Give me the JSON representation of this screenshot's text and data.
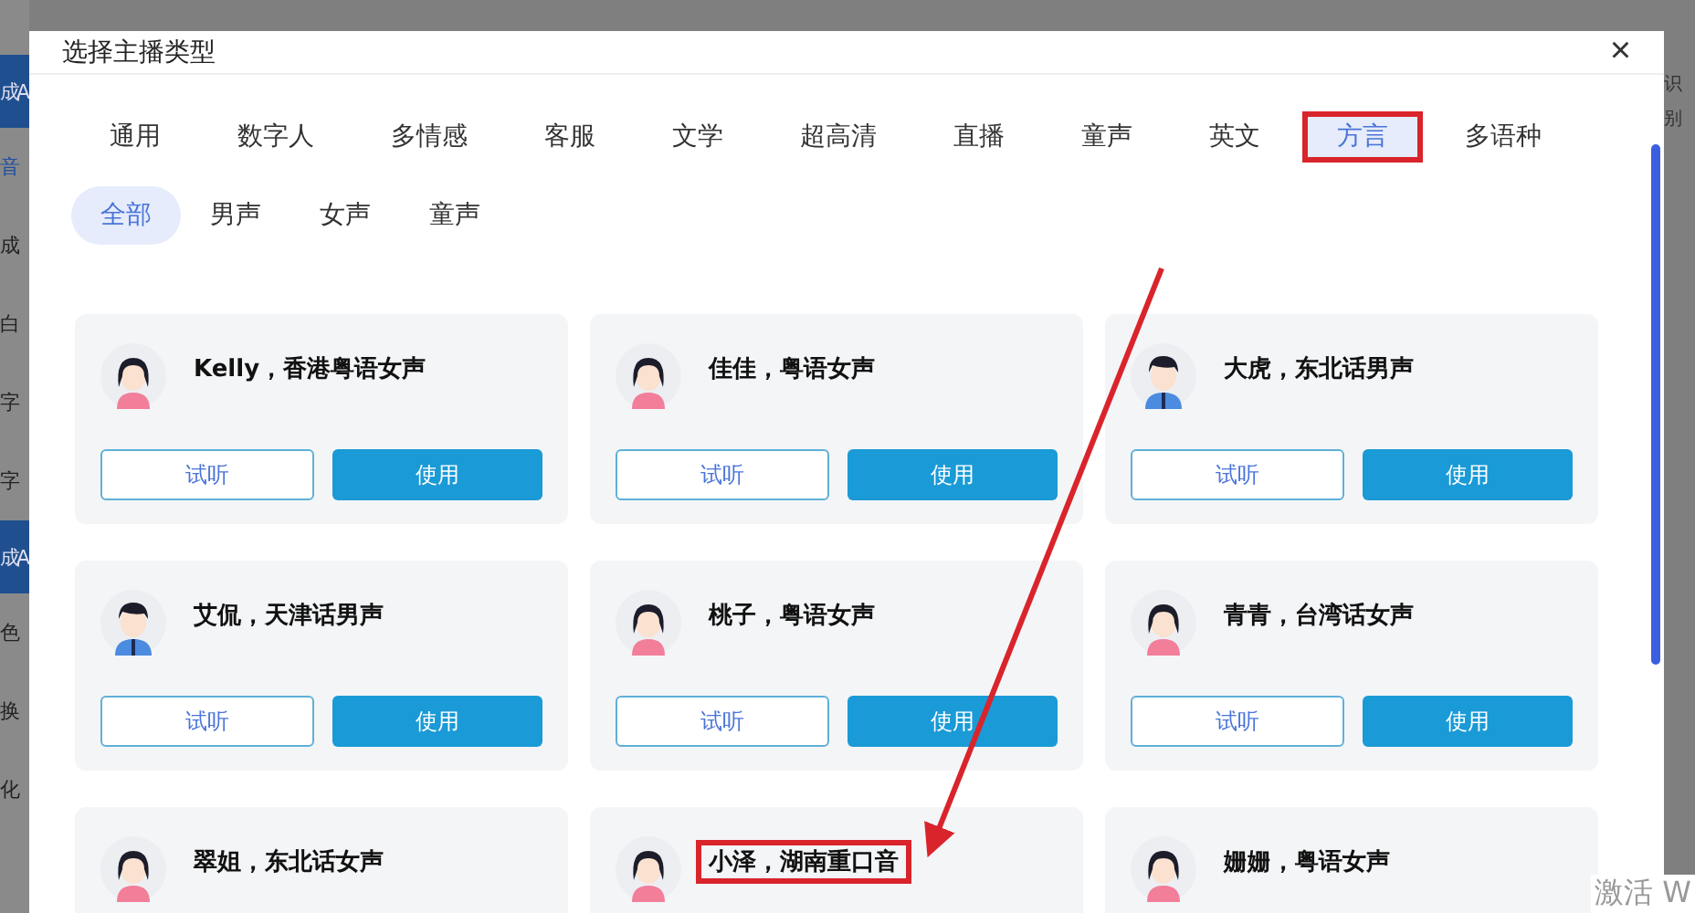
{
  "background": {
    "left_items": [
      {
        "text": "成A",
        "kind": "banner"
      },
      {
        "text": "音",
        "kind": "link"
      },
      {
        "text": "成",
        "kind": "plain"
      },
      {
        "text": "白",
        "kind": "plain"
      },
      {
        "text": "字",
        "kind": "plain"
      },
      {
        "text": "字",
        "kind": "plain"
      },
      {
        "text": "成A",
        "kind": "banner"
      },
      {
        "text": "色",
        "kind": "plain"
      },
      {
        "text": "换",
        "kind": "plain"
      },
      {
        "text": "化",
        "kind": "plain"
      }
    ],
    "right_text": "识别",
    "system_notice": "激活 W"
  },
  "dialog": {
    "title": "选择主播类型",
    "close": "×"
  },
  "tabs": [
    {
      "label": "通用",
      "selected": false,
      "highlighted": false
    },
    {
      "label": "数字人",
      "selected": false,
      "highlighted": false
    },
    {
      "label": "多情感",
      "selected": false,
      "highlighted": false
    },
    {
      "label": "客服",
      "selected": false,
      "highlighted": false
    },
    {
      "label": "文学",
      "selected": false,
      "highlighted": false
    },
    {
      "label": "超高清",
      "selected": false,
      "highlighted": false
    },
    {
      "label": "直播",
      "selected": false,
      "highlighted": false
    },
    {
      "label": "童声",
      "selected": false,
      "highlighted": false
    },
    {
      "label": "英文",
      "selected": false,
      "highlighted": false
    },
    {
      "label": "方言",
      "selected": true,
      "highlighted": true
    },
    {
      "label": "多语种",
      "selected": false,
      "highlighted": false
    }
  ],
  "filters": [
    {
      "label": "全部",
      "selected": true
    },
    {
      "label": "男声",
      "selected": false
    },
    {
      "label": "女声",
      "selected": false
    },
    {
      "label": "童声",
      "selected": false
    }
  ],
  "voices": [
    {
      "name": "Kelly，香港粤语女声",
      "kind": "female",
      "highlighted": false,
      "preview": "试听",
      "use": "使用"
    },
    {
      "name": "佳佳，粤语女声",
      "kind": "female",
      "highlighted": false,
      "preview": "试听",
      "use": "使用"
    },
    {
      "name": "大虎，东北话男声",
      "kind": "male",
      "highlighted": false,
      "preview": "试听",
      "use": "使用"
    },
    {
      "name": "艾侃，天津话男声",
      "kind": "male",
      "highlighted": false,
      "preview": "试听",
      "use": "使用"
    },
    {
      "name": "桃子，粤语女声",
      "kind": "female",
      "highlighted": false,
      "preview": "试听",
      "use": "使用"
    },
    {
      "name": "青青，台湾话女声",
      "kind": "female",
      "highlighted": false,
      "preview": "试听",
      "use": "使用"
    },
    {
      "name": "翠姐，东北话女声",
      "kind": "female",
      "highlighted": false
    },
    {
      "name": "小泽，湖南重口音",
      "kind": "female",
      "highlighted": true
    },
    {
      "name": "姗姗，粤语女声",
      "kind": "female",
      "highlighted": false
    }
  ]
}
